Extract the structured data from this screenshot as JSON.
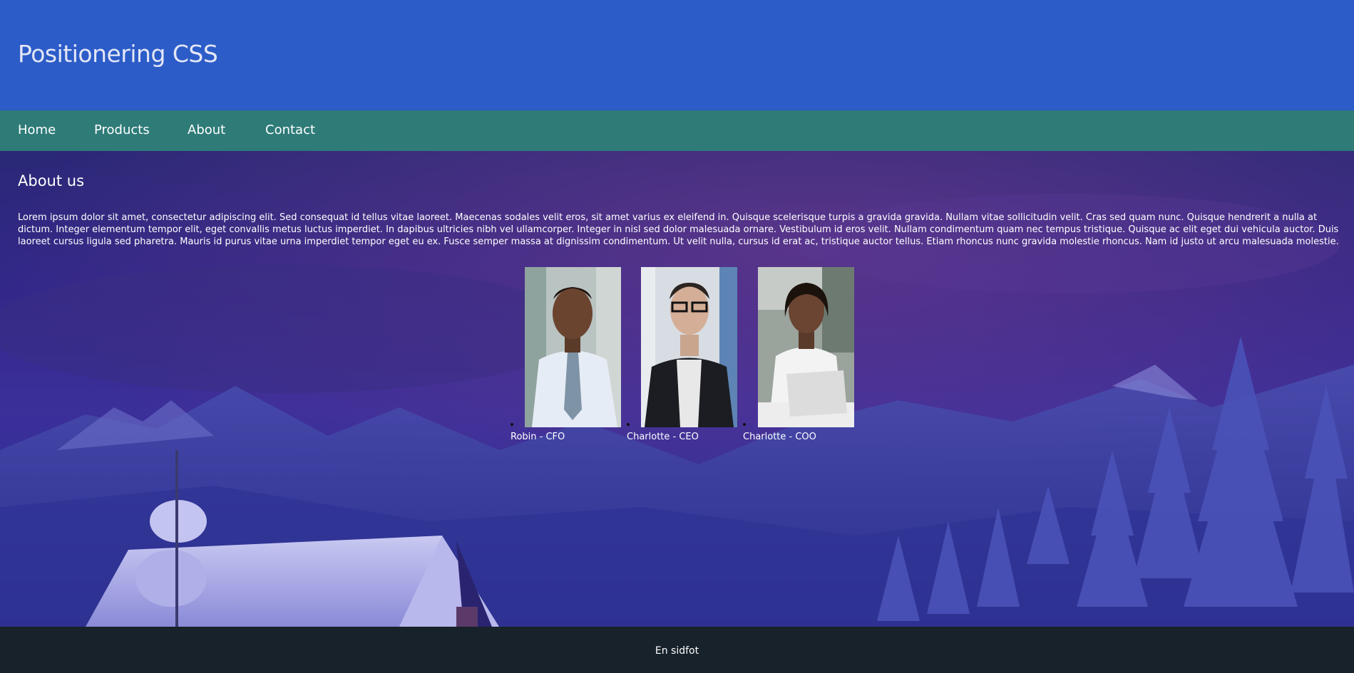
{
  "header": {
    "title": "Positionering CSS"
  },
  "nav": {
    "items": [
      "Home",
      "Products",
      "About",
      "Contact"
    ]
  },
  "main": {
    "heading": "About us",
    "paragraph": "Lorem ipsum dolor sit amet, consectetur adipiscing elit. Sed consequat id tellus vitae laoreet. Maecenas sodales velit eros, sit amet varius ex eleifend in. Quisque scelerisque turpis a gravida gravida. Nullam vitae sollicitudin velit. Cras sed quam nunc. Quisque hendrerit a nulla at dictum. Integer elementum tempor elit, eget convallis metus luctus imperdiet. In dapibus ultricies nibh vel ullamcorper. Integer in nisl sed dolor malesuada ornare. Vestibulum id eros velit. Nullam condimentum quam nec tempus tristique. Quisque ac elit eget dui vehicula auctor. Duis laoreet cursus ligula sed pharetra. Mauris id purus vitae urna imperdiet tempor eget eu ex. Fusce semper massa at dignissim condimentum. Ut velit nulla, cursus id erat ac, tristique auctor tellus. Etiam rhoncus nunc gravida molestie rhoncus. Nam id justo ut arcu malesuada molestie.",
    "team": [
      {
        "caption": "Robin - CFO"
      },
      {
        "caption": "Charlotte - CEO"
      },
      {
        "caption": "Charlotte - COO"
      }
    ]
  },
  "footer": {
    "text": "En sidfot"
  },
  "colors": {
    "header_bg": "#2c5cc8",
    "nav_bg": "#2e7b78",
    "footer_bg": "#17222a",
    "text": "#ffffff"
  }
}
